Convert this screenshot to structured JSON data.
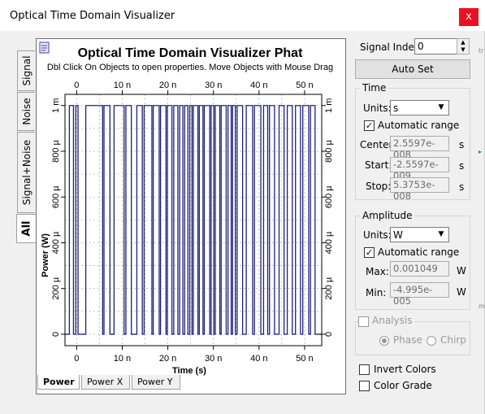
{
  "window": {
    "title": "Optical Time Domain Visualizer",
    "close_glyph": "x"
  },
  "side_tabs": [
    {
      "label": "Signal",
      "active": false
    },
    {
      "label": "Noise",
      "active": false
    },
    {
      "label": "Signal+Noise",
      "active": false
    },
    {
      "label": "All",
      "active": true
    }
  ],
  "plot": {
    "title": "Optical Time Domain Visualizer Phat",
    "subtitle": "Dbl Click On Objects to open properties.  Move Objects with Mouse Drag",
    "x_label": "Time (s)",
    "y_label": "Power (W)",
    "colors": {
      "trace": "#20207a",
      "grid": "#9a9a9a"
    }
  },
  "bottom_tabs": [
    {
      "label": "Power",
      "active": true
    },
    {
      "label": "Power X",
      "active": false
    },
    {
      "label": "Power Y",
      "active": false
    }
  ],
  "controls": {
    "signal_index_label": "Signal Index:",
    "signal_index_value": "0",
    "auto_set_label": "Auto Set",
    "time": {
      "title": "Time",
      "units_label": "Units:",
      "units_value": "s",
      "auto_range_label": "Automatic range",
      "auto_range_checked": true,
      "center_label": "Center:",
      "center_value": "2.5597e-008",
      "center_unit": "s",
      "start_label": "Start:",
      "start_value": "-2.5597e-009",
      "start_unit": "s",
      "stop_label": "Stop:",
      "stop_value": "5.3753e-008",
      "stop_unit": "s"
    },
    "amplitude": {
      "title": "Amplitude",
      "units_label": "Units:",
      "units_value": "W",
      "auto_range_label": "Automatic range",
      "auto_range_checked": true,
      "max_label": "Max:",
      "max_value": "0.001049",
      "max_unit": "W",
      "min_label": "Min:",
      "min_value": "-4.995e-005",
      "min_unit": "W"
    },
    "analysis": {
      "title": "Analysis",
      "phase_label": "Phase",
      "chirp_label": "Chirp"
    },
    "invert_colors_label": "Invert Colors",
    "color_grade_label": "Color Grade"
  },
  "chart_data": {
    "type": "line",
    "xlabel": "Time (s)",
    "ylabel": "Power (W)",
    "xlim": [
      -2.5597e-09,
      5.3753e-08
    ],
    "ylim": [
      -4.995e-05,
      0.001049
    ],
    "x_ticks": [
      {
        "value": 0,
        "label": "0"
      },
      {
        "value": 1e-08,
        "label": "10 n"
      },
      {
        "value": 2e-08,
        "label": "20 n"
      },
      {
        "value": 3e-08,
        "label": "30 n"
      },
      {
        "value": 4e-08,
        "label": "40 n"
      },
      {
        "value": 5e-08,
        "label": "50 n"
      }
    ],
    "y_ticks": [
      {
        "value": 0,
        "label": "0"
      },
      {
        "value": 0.0002,
        "label": "200 µ"
      },
      {
        "value": 0.0004,
        "label": "400 µ"
      },
      {
        "value": 0.0006,
        "label": "600 µ"
      },
      {
        "value": 0.0008,
        "label": "800 µ"
      },
      {
        "value": 0.001,
        "label": "1 m"
      }
    ],
    "grid": true,
    "series": [
      {
        "high": 0.001,
        "low": 0,
        "high_intervals_ns": [
          [
            -1.6,
            -0.7
          ],
          [
            -0.2,
            0.3
          ],
          [
            2.0,
            5.7
          ],
          [
            6.0,
            7.3
          ],
          [
            8.2,
            10.4
          ],
          [
            10.8,
            12.0
          ],
          [
            13.2,
            14.4
          ],
          [
            14.8,
            16.5
          ],
          [
            16.8,
            18.1
          ],
          [
            18.4,
            19.6
          ],
          [
            19.9,
            20.9
          ],
          [
            21.3,
            22.2
          ],
          [
            22.6,
            23.3
          ],
          [
            23.7,
            24.4
          ],
          [
            24.8,
            25.3
          ],
          [
            25.6,
            26.6
          ],
          [
            26.9,
            27.7
          ],
          [
            28.0,
            29.2
          ],
          [
            29.5,
            30.1
          ],
          [
            30.4,
            31.4
          ],
          [
            31.7,
            32.8
          ],
          [
            33.2,
            33.9
          ],
          [
            34.2,
            34.8
          ],
          [
            35.2,
            36.4
          ],
          [
            37.2,
            38.6
          ],
          [
            39.0,
            40.4
          ],
          [
            41.0,
            41.9
          ],
          [
            42.3,
            43.4
          ],
          [
            44.4,
            45.5
          ],
          [
            46.2,
            47.3
          ],
          [
            48.0,
            49.1
          ],
          [
            49.6,
            50.9
          ],
          [
            51.3,
            52.3
          ]
        ]
      }
    ]
  }
}
